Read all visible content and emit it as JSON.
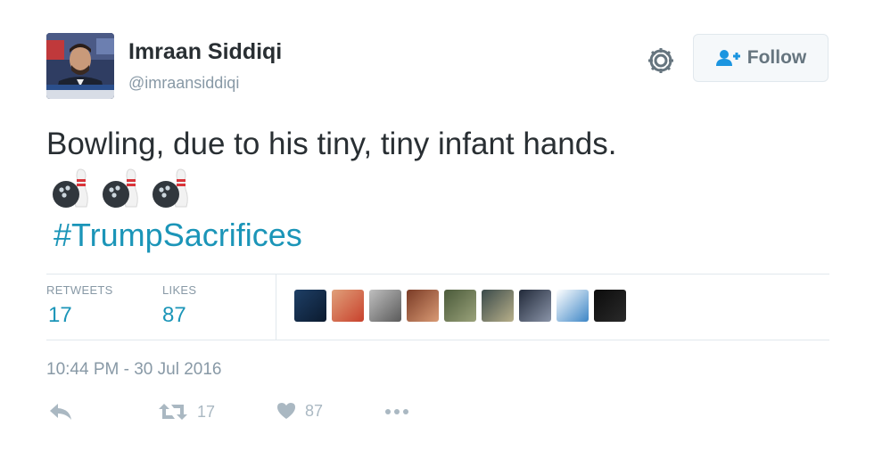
{
  "tweet": {
    "author_name": "Imraan Siddiqi",
    "author_handle": "@imraansiddiqi",
    "follow_label": "Follow",
    "text": "Bowling, due to his tiny, tiny infant hands.",
    "emoji_icons": [
      "bowling-icon",
      "bowling-icon",
      "bowling-icon"
    ],
    "hashtag": "#TrumpSacrifices",
    "timestamp": "10:44 PM - 30 Jul 2016"
  },
  "stats": {
    "retweets_label": "RETWEETS",
    "retweets_count": "17",
    "likes_label": "LIKES",
    "likes_count": "87"
  },
  "liker_count": 9,
  "actions": {
    "reply_icon": "reply-icon",
    "retweet_icon": "retweet-icon",
    "retweet_count": "17",
    "like_icon": "heart-icon",
    "like_count": "87",
    "more_icon": "more-icon"
  },
  "colors": {
    "link": "#1b95b8",
    "muted": "#8899a6",
    "text": "#292f33",
    "icon": "#aab8c2"
  }
}
